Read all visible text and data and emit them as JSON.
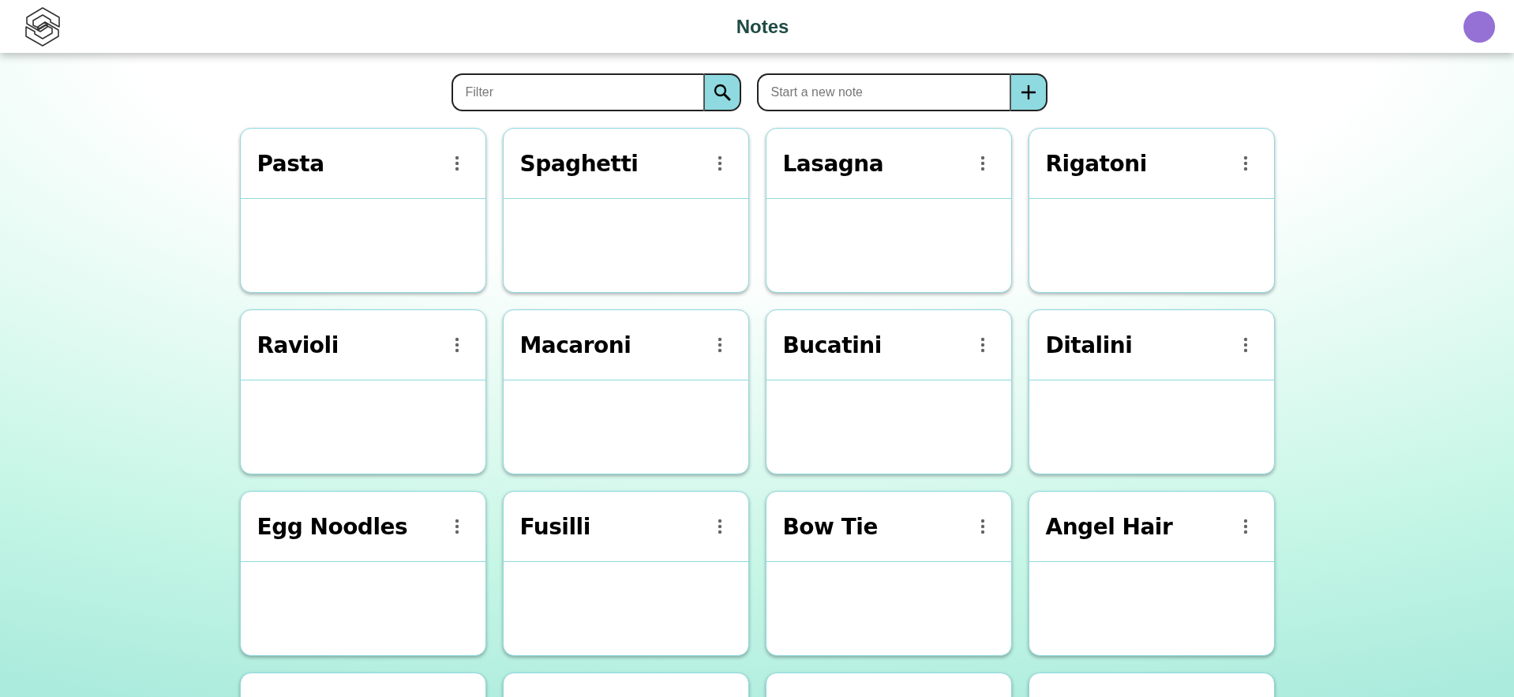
{
  "header": {
    "title": "Notes"
  },
  "filter": {
    "placeholder": "Filter"
  },
  "new_note": {
    "placeholder": "Start a new note"
  },
  "notes": [
    {
      "kind": "note",
      "title": "Pasta"
    },
    {
      "kind": "note",
      "title": "Spaghetti"
    },
    {
      "kind": "note",
      "title": "Lasagna"
    },
    {
      "kind": "note",
      "title": "Rigatoni"
    },
    {
      "kind": "note",
      "title": "Ravioli"
    },
    {
      "kind": "note",
      "title": "Macaroni"
    },
    {
      "kind": "note",
      "title": "Bucatini"
    },
    {
      "kind": "note",
      "title": "Ditalini"
    },
    {
      "kind": "note",
      "title": "Egg Noodles"
    },
    {
      "kind": "note",
      "title": "Fusilli"
    },
    {
      "kind": "note",
      "title": "Bow Tie"
    },
    {
      "kind": "note",
      "title": "Angel Hair"
    },
    {
      "kind": "cut"
    },
    {
      "kind": "cut"
    },
    {
      "kind": "cut"
    },
    {
      "kind": "cut"
    }
  ]
}
